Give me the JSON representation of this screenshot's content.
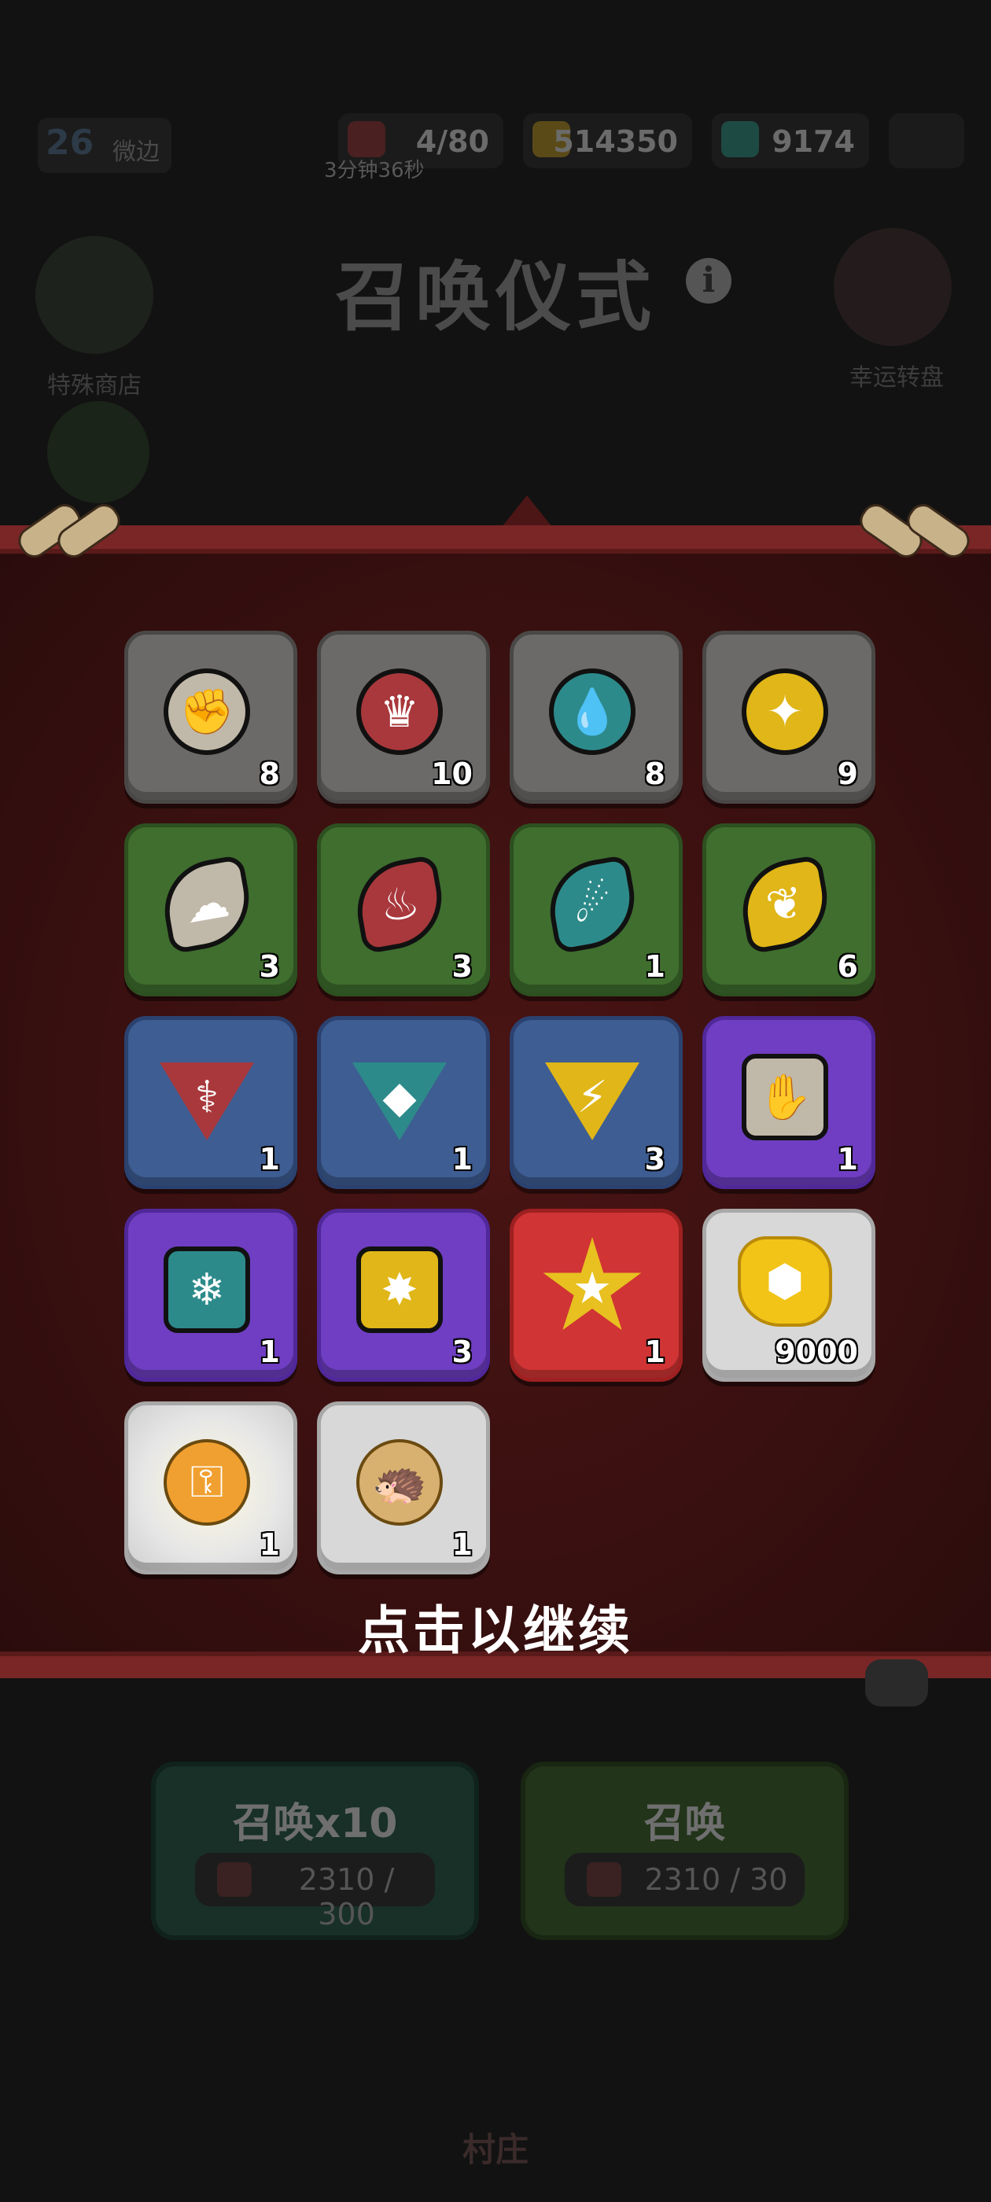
{
  "header": {
    "level": "26",
    "player_name": "微边",
    "energy": "4/80",
    "energy_timer": "3分钟36秒",
    "gold": "514350",
    "gems": "9174"
  },
  "title": "召唤仪式",
  "info_icon": "i",
  "side_labels": {
    "left": "特殊商店",
    "right": "幸运转盘"
  },
  "rewards": [
    {
      "color": "gray",
      "shape": "circle",
      "gem": "#c0b8a8",
      "icon": "fist-icon",
      "glyph": "✊",
      "count": "8"
    },
    {
      "color": "gray",
      "shape": "circle",
      "gem": "#a8383c",
      "icon": "crown-icon",
      "glyph": "♛",
      "count": "10"
    },
    {
      "color": "gray",
      "shape": "circle",
      "gem": "#2d8a8a",
      "icon": "drops-icon",
      "glyph": "💧",
      "count": "8"
    },
    {
      "color": "gray",
      "shape": "circle",
      "gem": "#e0b618",
      "icon": "spark-icon",
      "glyph": "✦",
      "count": "9"
    },
    {
      "color": "green",
      "shape": "leaf",
      "gem": "#c0b8a8",
      "icon": "cloud-fist-icon",
      "glyph": "☁",
      "count": "3"
    },
    {
      "color": "green",
      "shape": "leaf",
      "gem": "#a8383c",
      "icon": "flame-icon",
      "glyph": "♨",
      "count": "3"
    },
    {
      "color": "green",
      "shape": "leaf",
      "gem": "#2d8a8a",
      "icon": "comet-icon",
      "glyph": "☄",
      "count": "1"
    },
    {
      "color": "green",
      "shape": "leaf",
      "gem": "#e0b618",
      "icon": "plant-icon",
      "glyph": "❦",
      "count": "6"
    },
    {
      "color": "blue",
      "shape": "tri",
      "gem": "#a8383c",
      "icon": "fire-pillar-icon",
      "glyph": "⚕",
      "count": "1"
    },
    {
      "color": "blue",
      "shape": "tri",
      "gem": "#2d8a8a",
      "icon": "ice-crystal-icon",
      "glyph": "◆",
      "count": "1"
    },
    {
      "color": "blue",
      "shape": "tri",
      "gem": "#e0b618",
      "icon": "lightning-icon",
      "glyph": "⚡",
      "count": "3"
    },
    {
      "color": "purple",
      "shape": "square",
      "gem": "#c0b8a8",
      "icon": "claw-icon",
      "glyph": "✋",
      "count": "1"
    },
    {
      "color": "purple",
      "shape": "square",
      "gem": "#2d8a8a",
      "icon": "snowflake-icon",
      "glyph": "❄",
      "count": "1"
    },
    {
      "color": "purple",
      "shape": "square",
      "gem": "#e0b618",
      "icon": "burst-icon",
      "glyph": "✸",
      "count": "3"
    },
    {
      "color": "red",
      "shape": "star",
      "gem": "#e8c020",
      "icon": "star-lightning-icon",
      "glyph": "★",
      "count": "1"
    },
    {
      "color": "white",
      "shape": "nugget",
      "gem": "#f2c418",
      "icon": "gold-nugget-icon",
      "glyph": "⬢",
      "count": "9000"
    },
    {
      "color": "glow",
      "shape": "key",
      "gem": "#f0a030",
      "icon": "golden-key-icon",
      "glyph": "⚿",
      "count": "1"
    },
    {
      "color": "white",
      "shape": "creature",
      "gem": "#d8b070",
      "icon": "hedgehog-icon",
      "glyph": "🦔",
      "count": "1"
    }
  ],
  "continue_text": "点击以继续",
  "buttons": {
    "summon10": {
      "label": "召唤x10",
      "cost": "2310 / 300"
    },
    "summon": {
      "label": "召唤",
      "cost": "2310 / 30"
    }
  },
  "nav": {
    "village": "村庄"
  }
}
